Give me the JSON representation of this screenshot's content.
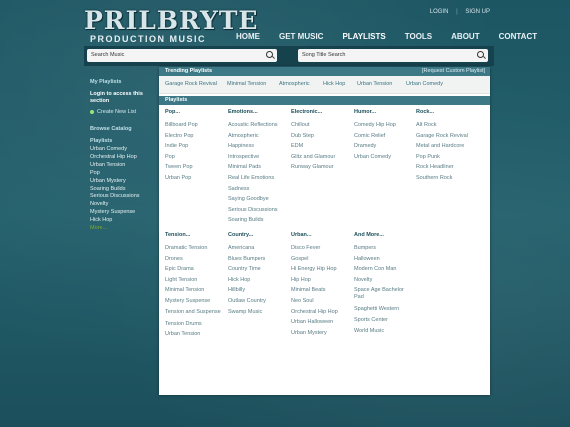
{
  "logo": {
    "word": "PRILBRYTE",
    "tagline": "PRODUCTION MUSIC"
  },
  "toplinks": {
    "login": "LOGIN",
    "signup": "SIGN UP",
    "separator": "|"
  },
  "nav": [
    {
      "label": "HOME"
    },
    {
      "label": "GET MUSIC"
    },
    {
      "label": "PLAYLISTS"
    },
    {
      "label": "TOOLS"
    },
    {
      "label": "ABOUT"
    },
    {
      "label": "CONTACT"
    }
  ],
  "search": {
    "music_placeholder": "Search Music",
    "title_placeholder": "Song Title Search"
  },
  "sidebar": {
    "my_playlists": "My Playlists",
    "login_text": "Login to access this section",
    "create_new": "Create New List",
    "browse_catalog": "Browse Catalog",
    "playlists_heading": "Playlists",
    "items": [
      "Urban Comedy",
      "Orchestral Hip Hop",
      "Urban Tension",
      "Pop",
      "Urban Mystery",
      "Soaring Builds",
      "Serious Discussions",
      "Novelty",
      "Mystery Suspense",
      "Hick Hop",
      "More..."
    ]
  },
  "trending": {
    "title": "Trending Playlists",
    "request_link": "[Request Custom Playlist]",
    "items": [
      "Garage Rock Revival",
      "Minimal Tension",
      "Atmospheric",
      "Hick Hop",
      "Urban Tension",
      "Urban Comedy"
    ]
  },
  "playlists": {
    "title": "Playlists",
    "top_columns": [
      {
        "heading": "Pop...",
        "items": [
          "Billboard Pop",
          "Electro Pop",
          "Indie Pop",
          "Pop",
          "Tween Pop",
          "Urban Pop"
        ]
      },
      {
        "heading": "Emotions...",
        "items": [
          "Acoustic Reflections",
          "Atmospheric",
          "Happiness",
          "Introspective",
          "Minimal Pads",
          "Real Life Emotions",
          "Sadness",
          "Saying Goodbye",
          "Serious Discussions",
          "Soaring Builds"
        ]
      },
      {
        "heading": "Electronic...",
        "items": [
          "Chillout",
          "Dub Step",
          "EDM",
          "Glitz and Glamour",
          "Runway Glamour"
        ]
      },
      {
        "heading": "Humor...",
        "items": [
          "Comedy Hip Hop",
          "Comic Relief",
          "Dramedy",
          "Urban Comedy"
        ]
      },
      {
        "heading": "Rock...",
        "items": [
          "Alt Rock",
          "Garage Rock Revival",
          "Metal and Hardcore",
          "Pop Punk",
          "Rock Headliner",
          "Southern Rock"
        ]
      }
    ],
    "bottom_columns": [
      {
        "heading": "Tension...",
        "items": [
          "Dramatic Tension",
          "Drones",
          "Epic Drama",
          "Light Tension",
          "Minimal Tension",
          "Mystery Suspense",
          "Tension and Suspense",
          "Tension Drums",
          "Urban Tension"
        ]
      },
      {
        "heading": "Country...",
        "items": [
          "Americana",
          "Blues Bumpers",
          "Country Time",
          "Hick Hop",
          "Hillbilly",
          "Outlaw Country",
          "Swamp Music"
        ]
      },
      {
        "heading": "Urban...",
        "items": [
          "Disco Fever",
          "Gospel",
          "Hi Energy Hip Hop",
          "Hip Hop",
          "Minimal Beats",
          "Neo Soul",
          "Orchestral Hip Hop",
          "Urban Halloween",
          "Urban Mystery"
        ]
      },
      {
        "heading": "And More...",
        "items": [
          "Bumpers",
          "Halloween",
          "Modern Con Man",
          "Novelty",
          "Space Age Bachelor Pad",
          "Spaghetti Western",
          "Sports Center",
          "World Music"
        ]
      }
    ]
  }
}
